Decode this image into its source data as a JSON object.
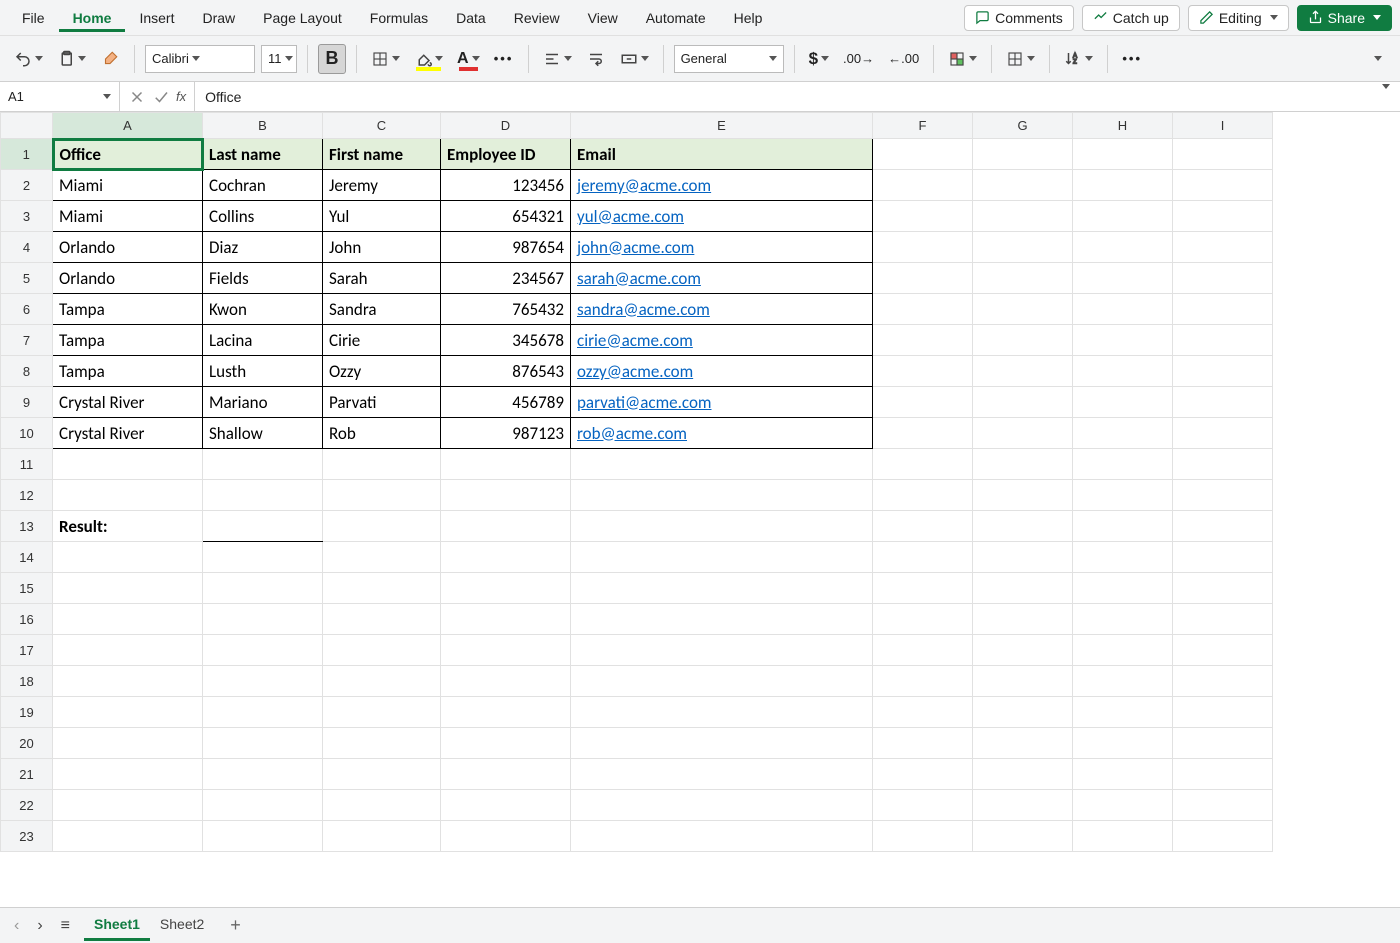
{
  "menu": {
    "items": [
      "File",
      "Home",
      "Insert",
      "Draw",
      "Page Layout",
      "Formulas",
      "Data",
      "Review",
      "View",
      "Automate",
      "Help"
    ],
    "active": "Home"
  },
  "topRight": {
    "comments": "Comments",
    "catchup": "Catch up",
    "editing": "Editing",
    "share": "Share"
  },
  "toolbar": {
    "fontName": "Calibri",
    "fontSize": "11",
    "numberFormat": "General",
    "boldActive": true
  },
  "formulaBar": {
    "nameBox": "A1",
    "formula": "Office"
  },
  "columns": [
    "A",
    "B",
    "C",
    "D",
    "E",
    "F",
    "G",
    "H",
    "I"
  ],
  "rowCount": 23,
  "selection": {
    "row": 1,
    "col": "A"
  },
  "table": {
    "headers": [
      "Office",
      "Last name",
      "First name",
      "Employee ID",
      "Email"
    ],
    "rows": [
      [
        "Miami",
        "Cochran",
        "Jeremy",
        "123456",
        "jeremy@acme.com"
      ],
      [
        "Miami",
        "Collins",
        "Yul",
        "654321",
        "yul@acme.com"
      ],
      [
        "Orlando",
        "Diaz",
        "John",
        "987654",
        "john@acme.com"
      ],
      [
        "Orlando",
        "Fields",
        "Sarah",
        "234567",
        "sarah@acme.com"
      ],
      [
        "Tampa",
        "Kwon",
        "Sandra",
        "765432",
        "sandra@acme.com"
      ],
      [
        "Tampa",
        "Lacina",
        "Cirie",
        "345678",
        "cirie@acme.com"
      ],
      [
        "Tampa",
        "Lusth",
        "Ozzy",
        "876543",
        "ozzy@acme.com"
      ],
      [
        "Crystal River",
        "Mariano",
        "Parvati",
        "456789",
        "parvati@acme.com"
      ],
      [
        "Crystal River",
        "Shallow",
        "Rob",
        "987123",
        "rob@acme.com"
      ]
    ]
  },
  "extraRows": {
    "13": {
      "A": {
        "text": "Result:",
        "bold": true
      }
    }
  },
  "sheetTabs": {
    "sheets": [
      "Sheet1",
      "Sheet2"
    ],
    "active": "Sheet1"
  }
}
